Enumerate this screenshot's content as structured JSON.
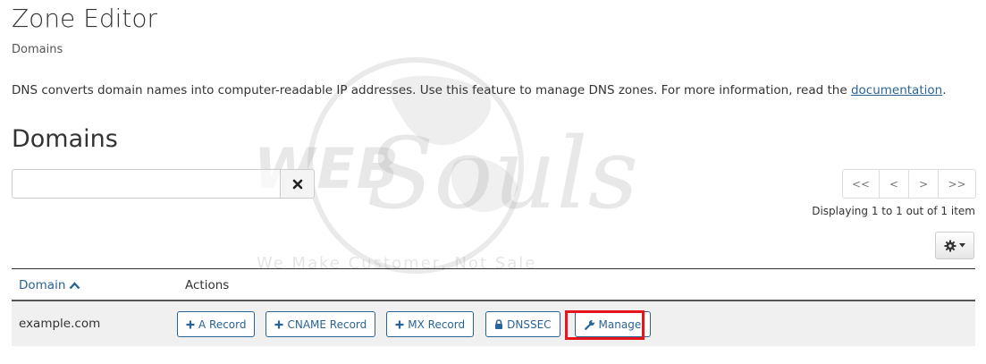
{
  "page": {
    "title": "Zone Editor",
    "breadcrumb": "Domains",
    "intro_text": "DNS converts domain names into computer-readable IP addresses. Use this feature to manage DNS zones. For more information, read the ",
    "intro_link": "documentation",
    "intro_end": "."
  },
  "watermark": {
    "word1": "WEB",
    "word2": "Souls",
    "tagline": "We Make Customer, Not Sale"
  },
  "domains_section": {
    "title": "Domains",
    "search": {
      "value": "",
      "placeholder": ""
    },
    "pager": [
      "<<",
      "<",
      ">",
      ">>"
    ],
    "displaying": "Displaying 1 to 1 out of 1 item"
  },
  "table": {
    "columns": {
      "domain": "Domain",
      "actions": "Actions"
    },
    "rows": [
      {
        "domain": "example.com",
        "actions": {
          "a_record": "A Record",
          "cname_record": "CNAME Record",
          "mx_record": "MX Record",
          "dnssec": "DNSSEC",
          "manage": "Manage"
        }
      }
    ]
  },
  "icons": {
    "clear": "close-icon",
    "sort": "chevron-up-icon",
    "settings": "gear-icon",
    "plus": "plus-icon",
    "lock": "lock-icon",
    "wrench": "wrench-icon"
  },
  "colors": {
    "link": "#2a6496",
    "highlight": "#e8141c",
    "row_background": "#f0f0f0"
  }
}
